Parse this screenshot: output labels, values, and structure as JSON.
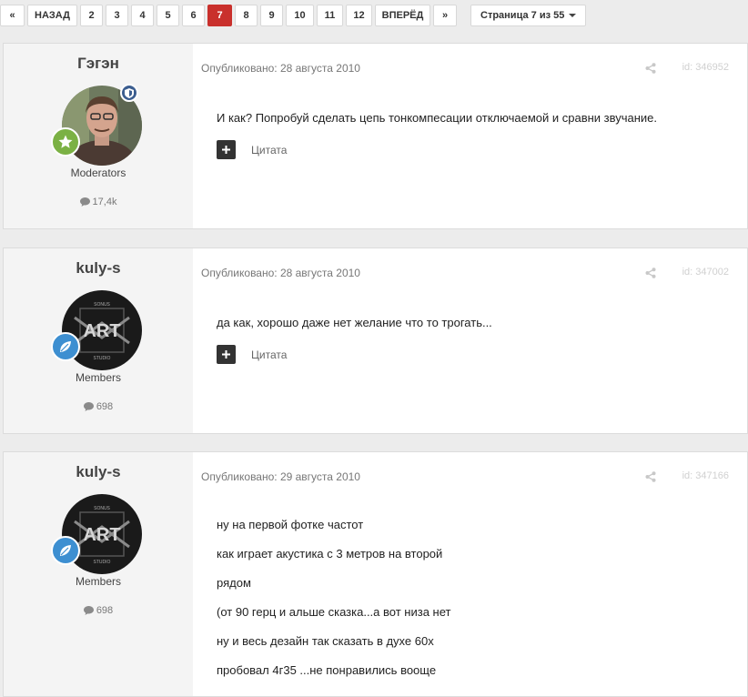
{
  "pagination": {
    "first": "«",
    "prev": "НАЗАД",
    "pages": [
      "2",
      "3",
      "4",
      "5",
      "6",
      "7",
      "8",
      "9",
      "10",
      "11",
      "12"
    ],
    "current": "7",
    "next": "ВПЕРЁД",
    "last": "»",
    "dropdown_label": "Страница 7 из 55"
  },
  "posts": [
    {
      "author": "Гэгэн",
      "group": "Moderators",
      "post_count": "17,4k",
      "published": "Опубликовано: 28 августа 2010",
      "id": "id: 346952",
      "lines": [
        "И как? Попробуй сделать цепь тонкомпесации отключаемой и сравни звучание."
      ],
      "quote_label": "Цитата"
    },
    {
      "author": "kuly-s",
      "group": "Members",
      "post_count": "698",
      "published": "Опубликовано: 28 августа 2010",
      "id": "id: 347002",
      "lines": [
        "да как, хорошо даже нет желание что то трогать..."
      ],
      "quote_label": "Цитата",
      "avatar_text": [
        "SONUS",
        "ART",
        "STUDIO"
      ]
    },
    {
      "author": "kuly-s",
      "group": "Members",
      "post_count": "698",
      "published": "Опубликовано: 29 августа 2010",
      "id": "id: 347166",
      "lines": [
        "ну на первой фотке частот",
        "как играет акустика с 3 метров на второй",
        "рядом",
        "(от 90 герц и альше сказка...а вот низа нет",
        "ну и весь дезайн так сказать в духе 60х",
        "пробовал 4г35 ...не понравились вооще"
      ],
      "avatar_text": [
        "SONUS",
        "ART",
        "STUDIO"
      ]
    }
  ],
  "colors": {
    "accent_active_page": "#c9302c",
    "moderator_rank": "#7bb144",
    "member_rank": "#3d8fd1"
  }
}
